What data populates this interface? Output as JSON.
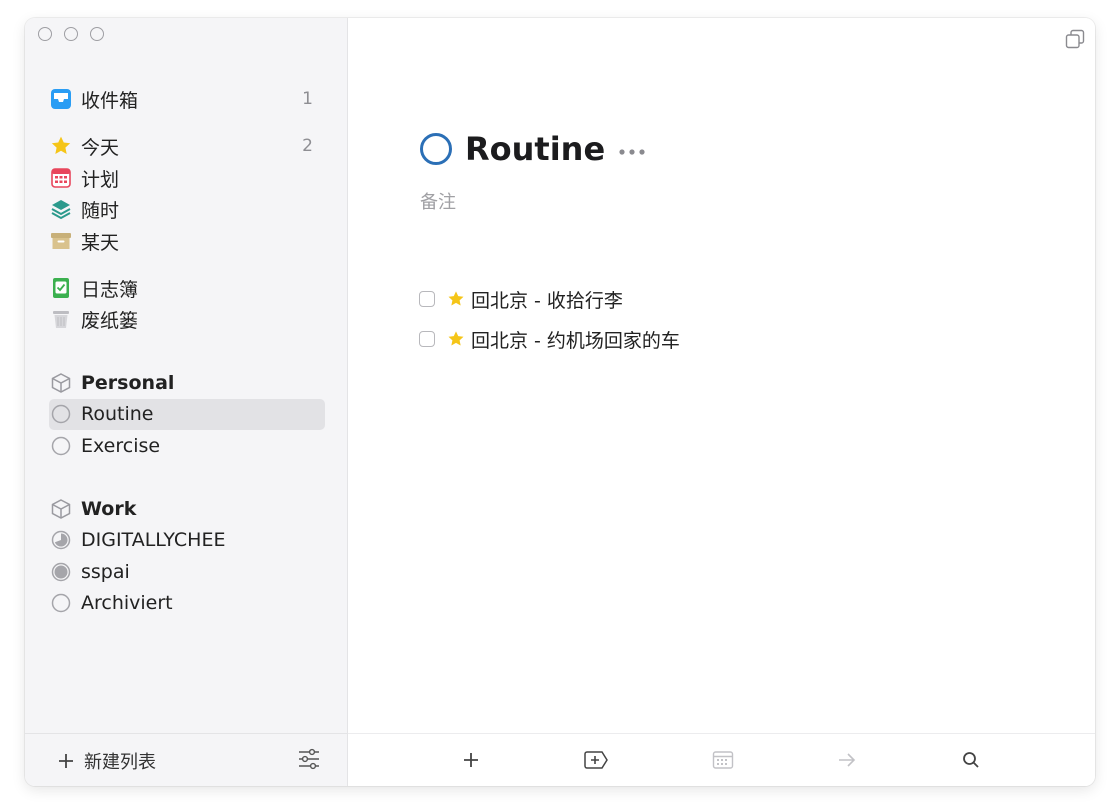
{
  "sidebar": {
    "inbox": {
      "label": "收件箱",
      "count": "1",
      "icon": "inbox-icon"
    },
    "today": {
      "label": "今天",
      "count": "2",
      "icon": "star-icon"
    },
    "upcoming": {
      "label": "计划",
      "icon": "calendar-icon"
    },
    "anytime": {
      "label": "随时",
      "icon": "layers-icon"
    },
    "someday": {
      "label": "某天",
      "icon": "archive-box-icon"
    },
    "logbook": {
      "label": "日志簿",
      "icon": "logbook-icon"
    },
    "trash": {
      "label": "废纸篓",
      "icon": "trash-icon"
    },
    "areas": [
      {
        "label": "Personal",
        "projects": [
          {
            "label": "Routine",
            "selected": true
          },
          {
            "label": "Exercise"
          }
        ]
      },
      {
        "label": "Work",
        "projects": [
          {
            "label": "DIGITALLYCHEE"
          },
          {
            "label": "sspai"
          },
          {
            "label": "Archiviert"
          }
        ]
      }
    ],
    "footer": {
      "new_list_label": "新建列表"
    }
  },
  "main": {
    "title": "Routine",
    "notes_placeholder": "备注",
    "todos": [
      {
        "text": "回北京 - 收拾行李",
        "starred": true,
        "checked": false
      },
      {
        "text": "回北京 - 约机场回家的车",
        "starred": true,
        "checked": false
      }
    ],
    "toolbar": [
      "plus-icon",
      "add-heading-icon",
      "calendar-icon",
      "arrow-right-icon",
      "search-icon"
    ]
  },
  "colors": {
    "accent_blue": "#2b6fb6",
    "inbox_blue": "#2a9df4",
    "today_yellow": "#f5c518",
    "plan_red": "#e8465c",
    "anytime_teal": "#2b9a8c",
    "someday_tan": "#c8b079",
    "logbook_green": "#3bb04f",
    "sidebar_bg": "#f5f5f7",
    "selected_bg": "#e2e2e5"
  }
}
